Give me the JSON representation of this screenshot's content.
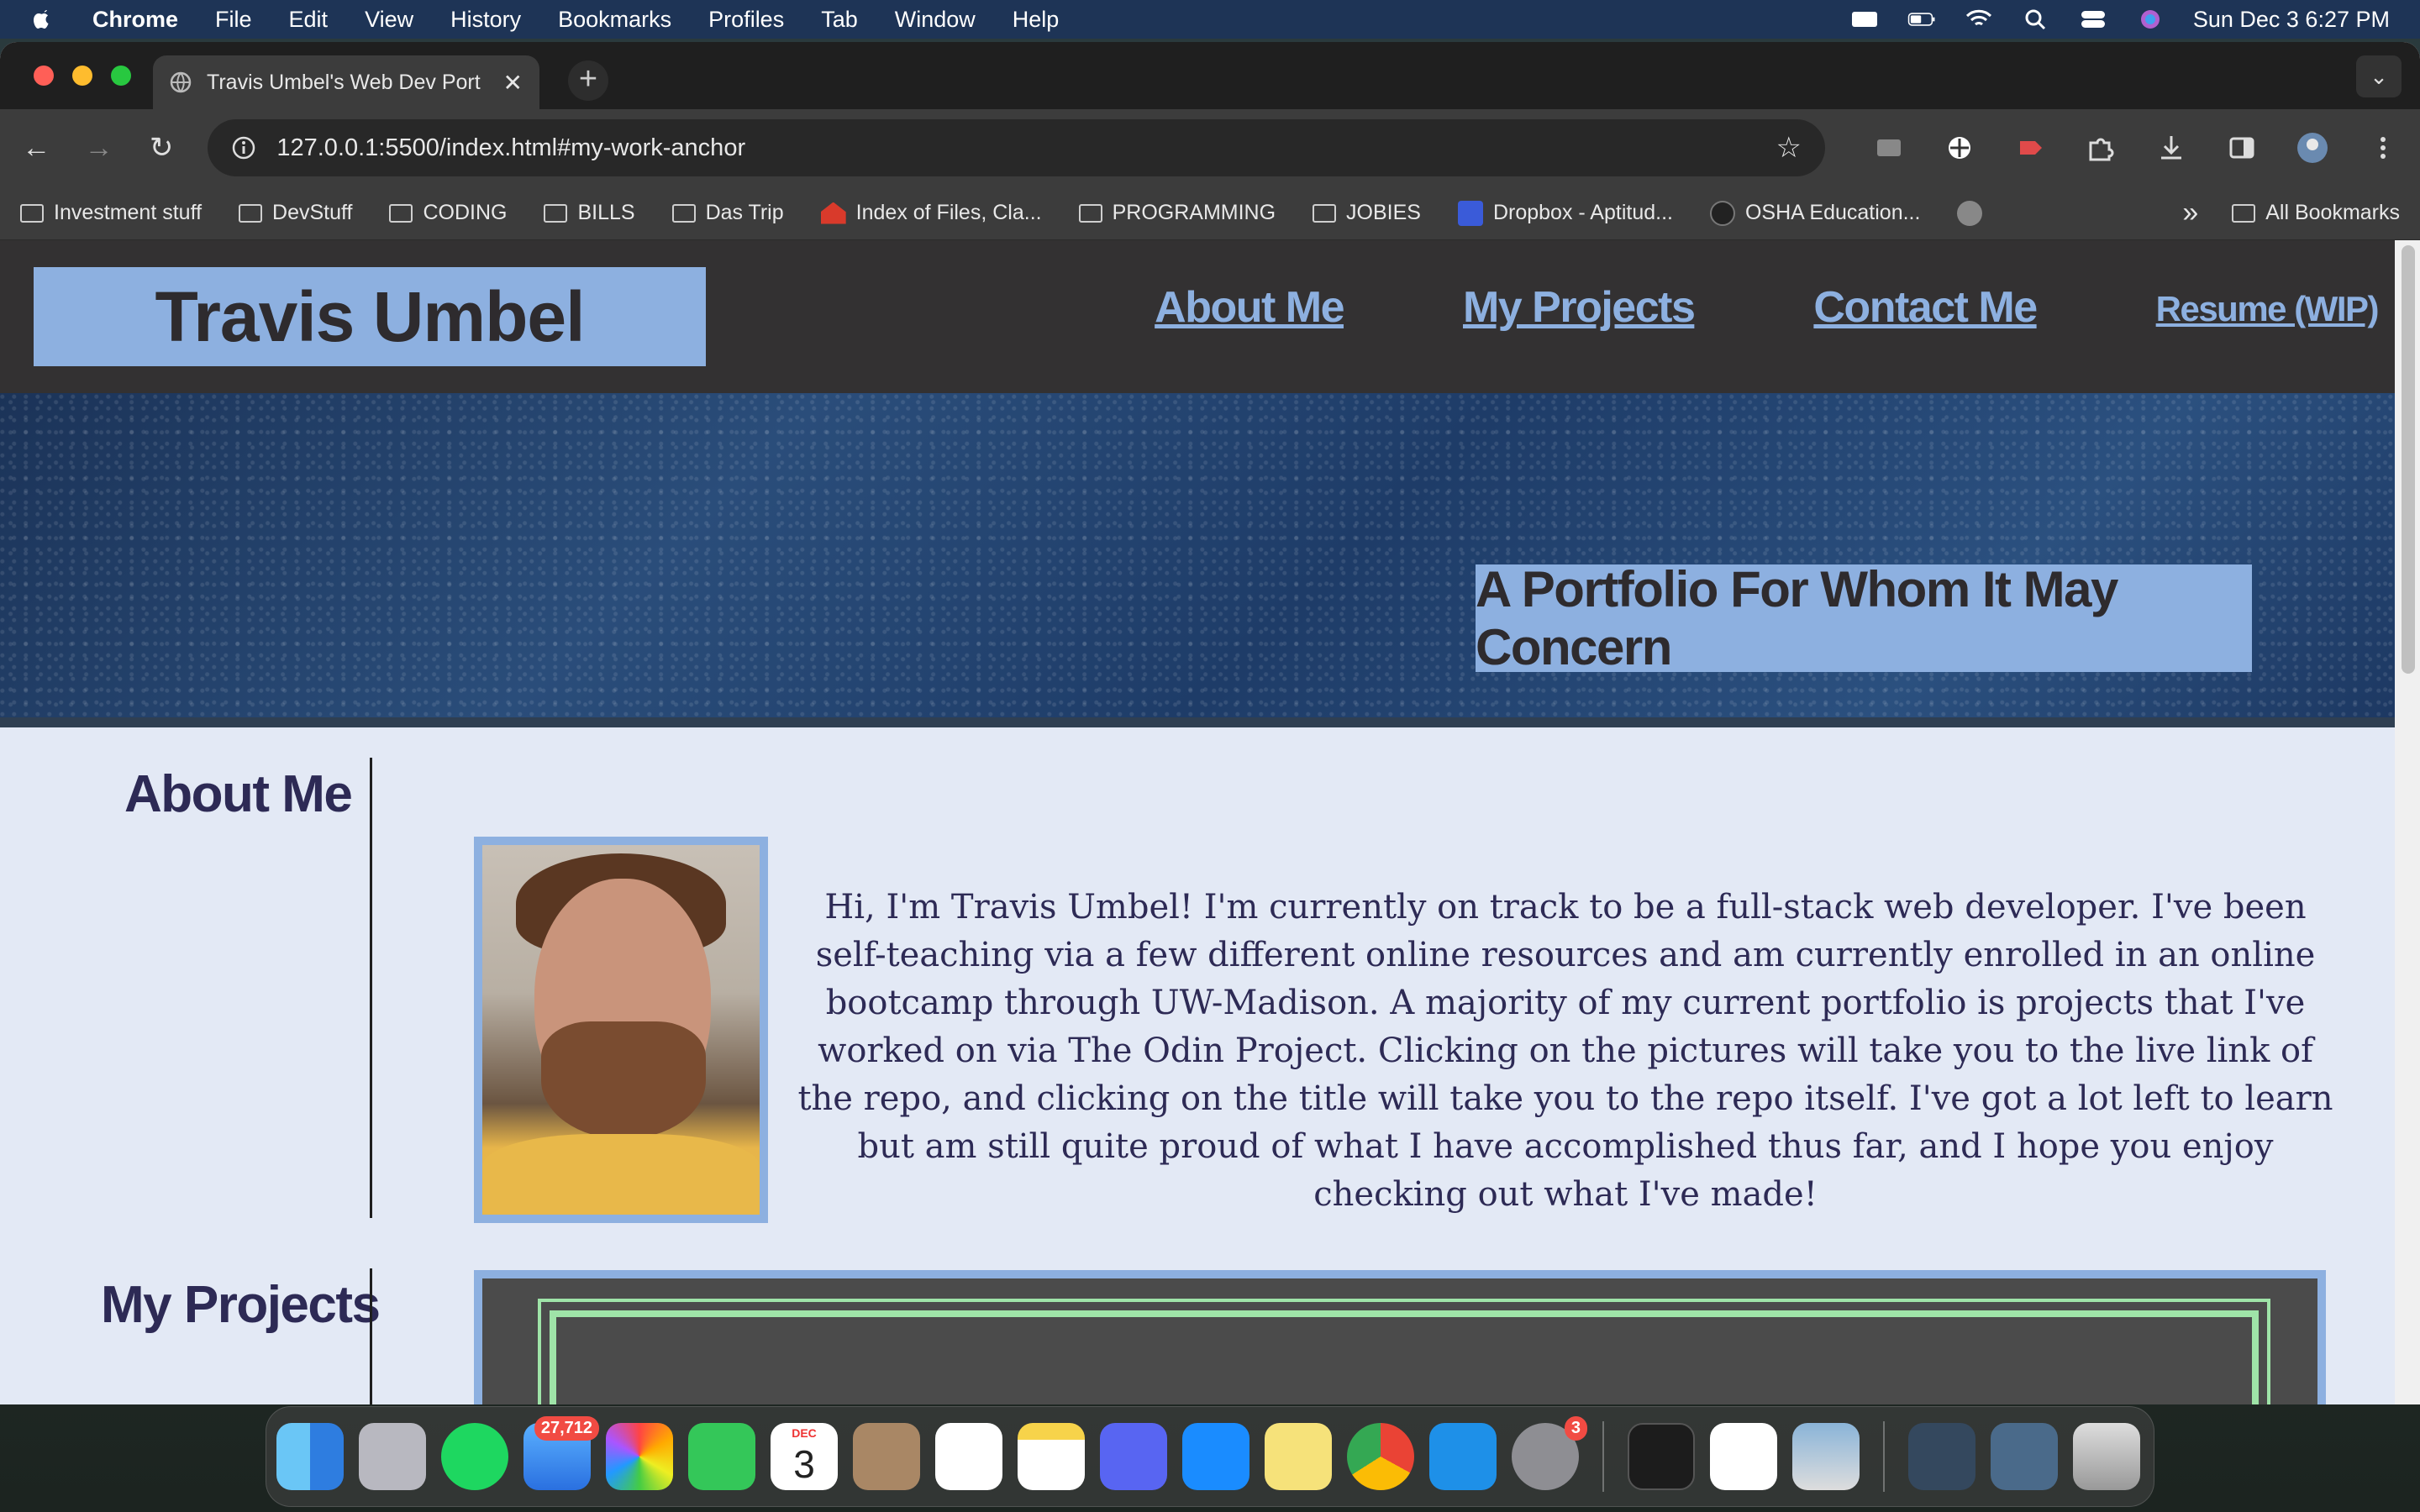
{
  "menubar": {
    "app": "Chrome",
    "items": [
      "File",
      "Edit",
      "View",
      "History",
      "Bookmarks",
      "Profiles",
      "Tab",
      "Window",
      "Help"
    ],
    "datetime": "Sun Dec 3  6:27 PM"
  },
  "browser": {
    "tab_title": "Travis Umbel's Web Dev Port",
    "url": "127.0.0.1:5500/index.html#my-work-anchor",
    "bookmarks": [
      "Investment stuff",
      "DevStuff",
      "CODING",
      "BILLS",
      "Das Trip",
      "Index of Files, Cla...",
      "PROGRAMMING",
      "JOBIES",
      "Dropbox - Aptitud...",
      "OSHA Education..."
    ],
    "more_bookmarks": "»",
    "all_bookmarks": "All Bookmarks"
  },
  "site": {
    "logo": "Travis Umbel",
    "nav": [
      "About Me",
      "My Projects",
      "Contact Me",
      "Resume (WIP)"
    ],
    "hero_tagline": "A Portfolio For Whom It May Concern",
    "about_title": "About Me",
    "about_text": "Hi, I'm Travis Umbel! I'm currently on track to be a full-stack web developer. I've been self-teaching via a few different online resources and am currently enrolled in an online bootcamp through UW-Madison. A majority of my current portfolio is projects that I've worked on via The Odin Project. Clicking on the pictures will take you to the live link of the repo, and clicking on the title will take you to the repo itself. I've got a lot left to learn but am still quite proud of what I have accomplished thus far, and I hope you enjoy checking out what I've made!",
    "projects_title": "My Projects"
  },
  "dock": {
    "mail_badge": "27,712",
    "calendar_month": "DEC",
    "calendar_day": "3",
    "settings_badge": "3"
  },
  "colors": {
    "accent": "#8db0e0",
    "header_bg": "#333132",
    "page_bg": "#e3e9f5",
    "text": "#2d2a55",
    "project_border": "#9fe4a8"
  }
}
